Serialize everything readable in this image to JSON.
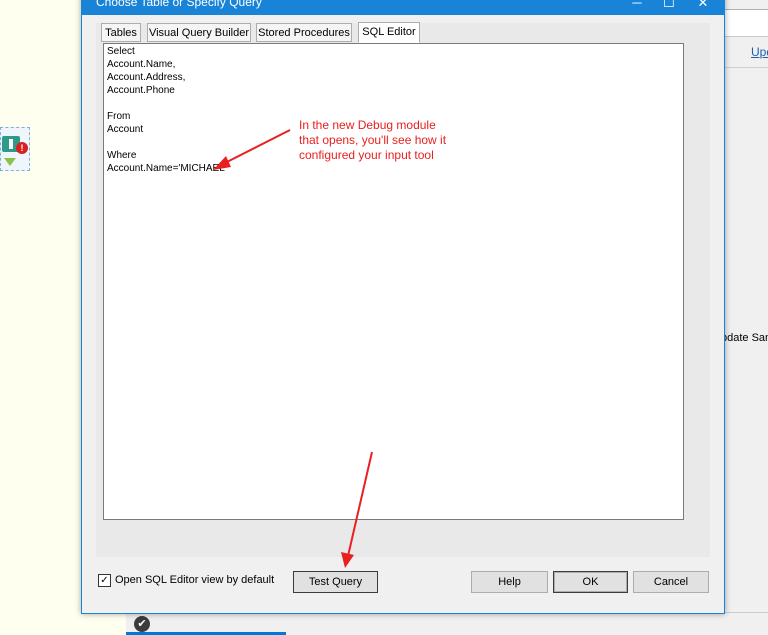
{
  "dialog": {
    "title": "Choose Table or Specify Query",
    "window_buttons": [
      "─",
      "☐",
      "✕"
    ]
  },
  "tabs": [
    {
      "label": "Tables"
    },
    {
      "label": "Visual Query Builder"
    },
    {
      "label": "Stored Procedures"
    },
    {
      "label": "SQL Editor",
      "active": true
    }
  ],
  "sql_lines": [
    "Select",
    "Account.Name,",
    "Account.Address,",
    "Account.Phone",
    "",
    "From",
    "Account",
    "",
    "Where",
    "Account.Name='MICHAEL'"
  ],
  "annotation": {
    "lines": [
      "In the new Debug module",
      "that opens, you'll see how it",
      "configured your input tool"
    ],
    "color": "#e82020"
  },
  "footer": {
    "checkbox_label": "Open SQL Editor view by default",
    "checkbox_checked": true,
    "test_query": "Test Query",
    "help": "Help",
    "ok": "OK",
    "cancel": "Cancel"
  },
  "background": {
    "right_link": "Upd",
    "right_text": "pdate Sam",
    "accent": "#1883d7"
  }
}
